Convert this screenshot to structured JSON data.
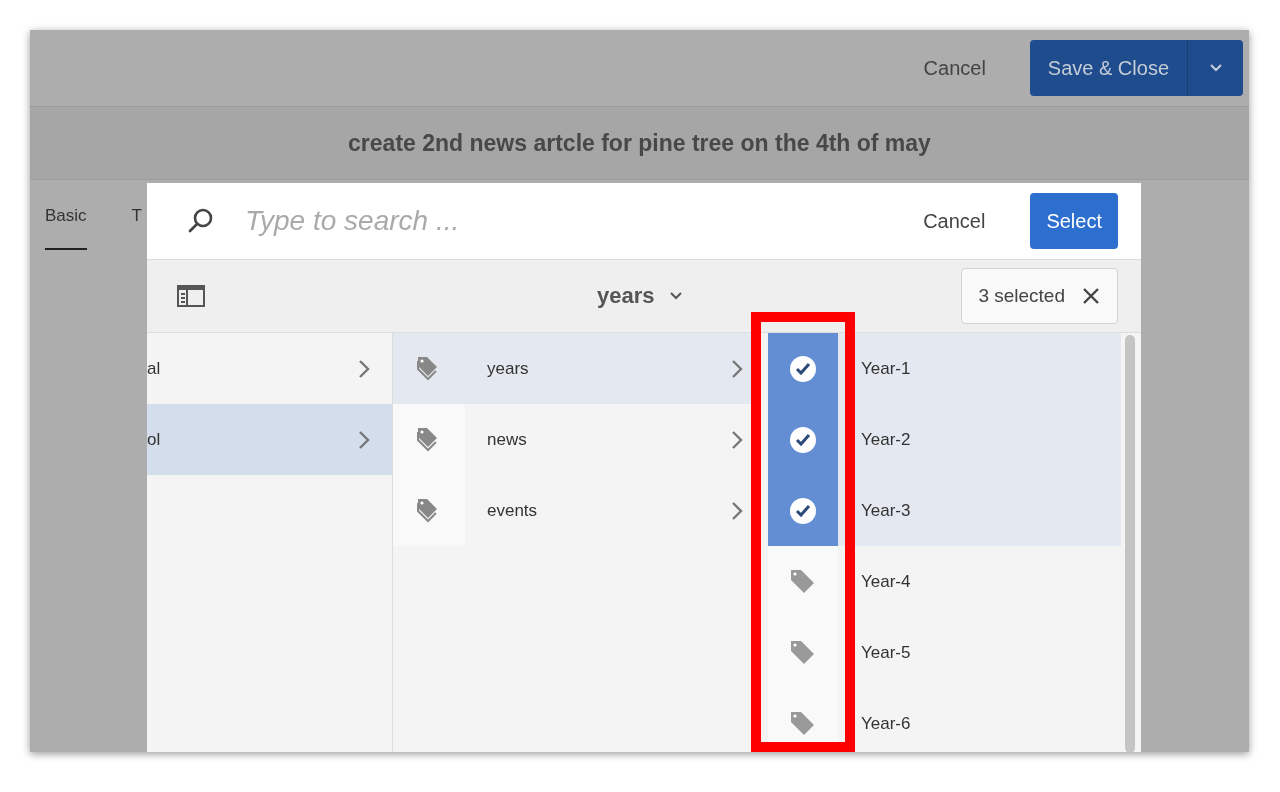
{
  "header": {
    "cancel": "Cancel",
    "save": "Save & Close",
    "title": "create 2nd news artcle for pine tree on the 4th of may"
  },
  "tabs": [
    {
      "label": "Basic",
      "selected": true
    },
    {
      "label": "T",
      "selected": false
    }
  ],
  "picker": {
    "search": {
      "placeholder": "Type to search ..."
    },
    "cancel": "Cancel",
    "select": "Select",
    "breadcrumb": "years",
    "selection": "3 selected",
    "column_1": [
      {
        "label": "al",
        "selected": false
      },
      {
        "label": "ol",
        "selected": true
      }
    ],
    "column_2": [
      {
        "label": "years",
        "selected": true
      },
      {
        "label": "news",
        "selected": false
      },
      {
        "label": "events",
        "selected": false
      }
    ],
    "column_3": [
      {
        "label": "Year-1",
        "checked": true
      },
      {
        "label": "Year-2",
        "checked": true
      },
      {
        "label": "Year-3",
        "checked": true
      },
      {
        "label": "Year-4",
        "checked": false
      },
      {
        "label": "Year-5",
        "checked": false
      },
      {
        "label": "Year-6",
        "checked": false
      }
    ]
  }
}
